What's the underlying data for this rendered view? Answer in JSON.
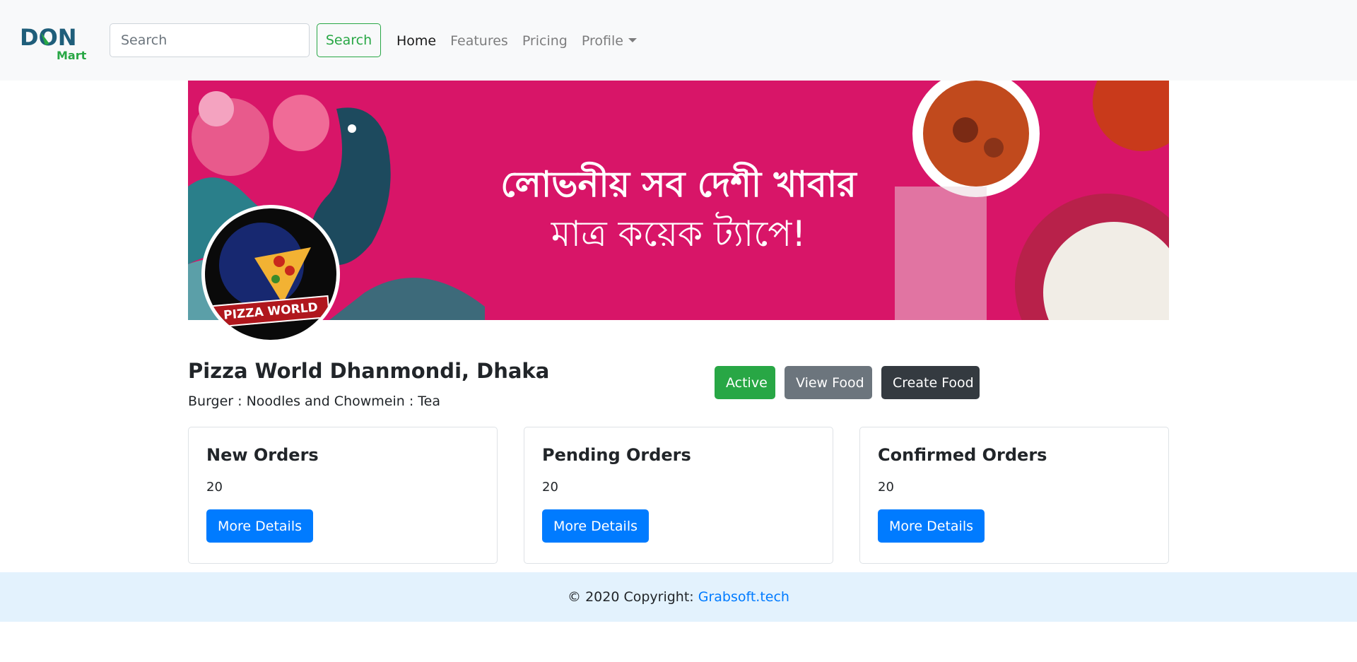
{
  "brand": {
    "name": "DON",
    "sub": "Mart"
  },
  "search": {
    "placeholder": "Search",
    "value": "",
    "button_label": "Search"
  },
  "nav": {
    "items": [
      {
        "label": "Home",
        "active": true
      },
      {
        "label": "Features",
        "active": false
      },
      {
        "label": "Pricing",
        "active": false
      },
      {
        "label": "Profile",
        "active": false,
        "dropdown": true
      }
    ]
  },
  "banner": {
    "line1": "লোভনীয় সব দেশী খাবার",
    "line2": "মাত্র কয়েক ট্যাপে!",
    "background_color": "#d81568"
  },
  "avatar": {
    "label": "PIZZA WORLD"
  },
  "shop": {
    "title": "Pizza World Dhanmondi, Dhaka",
    "categories": "Burger : Noodles and Chowmein : Tea"
  },
  "actions": {
    "active_label": "Active",
    "view_food_label": "View Food",
    "create_food_label": "Create Food"
  },
  "cards": [
    {
      "title": "New Orders",
      "value": "20",
      "button_label": "More Details"
    },
    {
      "title": "Pending Orders",
      "value": "20",
      "button_label": "More Details"
    },
    {
      "title": "Confirmed Orders",
      "value": "20",
      "button_label": "More Details"
    }
  ],
  "footer": {
    "text": "© 2020 Copyright:",
    "link_label": "Grabsoft.tech"
  },
  "colors": {
    "success": "#28a745",
    "secondary": "#6c757d",
    "dark": "#343a40",
    "primary": "#007bff",
    "footer_bg": "#e3f2fd"
  }
}
